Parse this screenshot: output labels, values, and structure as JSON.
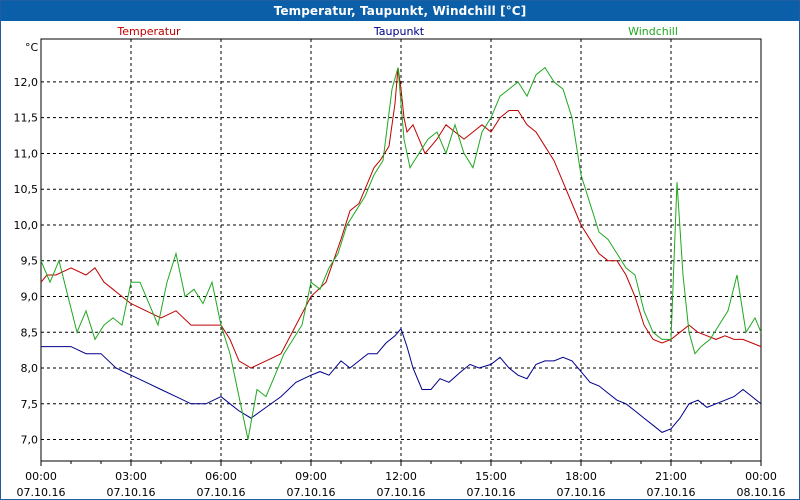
{
  "window": {
    "title": "Temperatur, Taupunkt, Windchill [°C]"
  },
  "colors": {
    "titlebar": "#0b5ea8",
    "grid": "#000000",
    "temperatur": "#c00000",
    "taupunkt": "#00008b",
    "windchill": "#1fa81f"
  },
  "chart_data": {
    "type": "line",
    "title": "Temperatur, Taupunkt, Windchill [°C]",
    "ylabel": "°C",
    "xlabel": "",
    "ylim": [
      6.7,
      12.6
    ],
    "xlim": [
      0,
      24
    ],
    "grid": true,
    "legend_placement": "top",
    "y_ticks": [
      {
        "value": 7.0,
        "label": "7,0"
      },
      {
        "value": 7.5,
        "label": "7,5"
      },
      {
        "value": 8.0,
        "label": "8,0"
      },
      {
        "value": 8.5,
        "label": "8,5"
      },
      {
        "value": 9.0,
        "label": "9,0"
      },
      {
        "value": 9.5,
        "label": "9,5"
      },
      {
        "value": 10.0,
        "label": "10,0"
      },
      {
        "value": 10.5,
        "label": "10,5"
      },
      {
        "value": 11.0,
        "label": "11,0"
      },
      {
        "value": 11.5,
        "label": "11,5"
      },
      {
        "value": 12.0,
        "label": "12,0"
      }
    ],
    "x_ticks": [
      {
        "value": 0,
        "time": "00:00",
        "date": "07.10.16"
      },
      {
        "value": 3,
        "time": "03:00",
        "date": "07.10.16"
      },
      {
        "value": 6,
        "time": "06:00",
        "date": "07.10.16"
      },
      {
        "value": 9,
        "time": "09:00",
        "date": "07.10.16"
      },
      {
        "value": 12,
        "time": "12:00",
        "date": "07.10.16"
      },
      {
        "value": 15,
        "time": "15:00",
        "date": "07.10.16"
      },
      {
        "value": 18,
        "time": "18:00",
        "date": "07.10.16"
      },
      {
        "value": 21,
        "time": "21:00",
        "date": "07.10.16"
      },
      {
        "value": 24,
        "time": "00:00",
        "date": "08.10.16"
      }
    ],
    "series": [
      {
        "name": "Temperatur",
        "color": "#c00000",
        "x": [
          0,
          0.2,
          0.5,
          1.0,
          1.5,
          1.8,
          2.1,
          2.4,
          2.7,
          3.0,
          3.5,
          4.0,
          4.5,
          5.0,
          5.5,
          6.0,
          6.3,
          6.6,
          7.0,
          7.5,
          8.0,
          8.5,
          9.0,
          9.5,
          10.0,
          10.3,
          10.6,
          10.9,
          11.1,
          11.3,
          11.6,
          11.8,
          11.9,
          12.0,
          12.1,
          12.2,
          12.4,
          12.6,
          12.8,
          13.0,
          13.2,
          13.5,
          13.8,
          14.1,
          14.4,
          14.7,
          15.0,
          15.3,
          15.6,
          15.9,
          16.2,
          16.5,
          16.8,
          17.1,
          17.4,
          17.7,
          18.0,
          18.3,
          18.6,
          18.9,
          19.2,
          19.5,
          19.8,
          20.1,
          20.4,
          20.7,
          21.0,
          21.3,
          21.6,
          21.9,
          22.2,
          22.5,
          22.8,
          23.1,
          23.4,
          23.7,
          24.0
        ],
        "values": [
          9.2,
          9.3,
          9.3,
          9.4,
          9.3,
          9.4,
          9.2,
          9.1,
          9.0,
          8.9,
          8.8,
          8.7,
          8.8,
          8.6,
          8.6,
          8.6,
          8.4,
          8.1,
          8.0,
          8.1,
          8.2,
          8.6,
          9.0,
          9.2,
          9.8,
          10.2,
          10.3,
          10.6,
          10.8,
          10.9,
          11.1,
          11.7,
          12.2,
          11.9,
          11.5,
          11.3,
          11.4,
          11.2,
          11.0,
          11.1,
          11.2,
          11.4,
          11.3,
          11.2,
          11.3,
          11.4,
          11.3,
          11.5,
          11.6,
          11.6,
          11.4,
          11.3,
          11.1,
          10.9,
          10.6,
          10.3,
          10.0,
          9.8,
          9.6,
          9.5,
          9.5,
          9.3,
          9.0,
          8.6,
          8.4,
          8.35,
          8.4,
          8.5,
          8.6,
          8.5,
          8.45,
          8.4,
          8.45,
          8.4,
          8.4,
          8.35,
          8.3
        ]
      },
      {
        "name": "Taupunkt",
        "color": "#00008b",
        "x": [
          0,
          0.5,
          1.0,
          1.5,
          2.0,
          2.5,
          3.0,
          3.5,
          4.0,
          4.5,
          5.0,
          5.5,
          6.0,
          6.3,
          6.6,
          7.0,
          7.5,
          8.0,
          8.5,
          9.0,
          9.3,
          9.6,
          10.0,
          10.3,
          10.6,
          10.9,
          11.2,
          11.5,
          11.8,
          12.0,
          12.2,
          12.4,
          12.7,
          13.0,
          13.3,
          13.6,
          14.0,
          14.3,
          14.6,
          15.0,
          15.3,
          15.6,
          15.9,
          16.2,
          16.5,
          16.8,
          17.1,
          17.4,
          17.7,
          18.0,
          18.3,
          18.6,
          18.9,
          19.2,
          19.5,
          19.8,
          20.1,
          20.4,
          20.7,
          21.0,
          21.3,
          21.6,
          21.9,
          22.2,
          22.5,
          22.8,
          23.1,
          23.4,
          23.7,
          24.0
        ],
        "values": [
          8.3,
          8.3,
          8.3,
          8.2,
          8.2,
          8.0,
          7.9,
          7.8,
          7.7,
          7.6,
          7.5,
          7.5,
          7.6,
          7.5,
          7.4,
          7.3,
          7.45,
          7.6,
          7.8,
          7.9,
          7.95,
          7.9,
          8.1,
          8.0,
          8.1,
          8.2,
          8.2,
          8.35,
          8.45,
          8.55,
          8.3,
          8.0,
          7.7,
          7.7,
          7.85,
          7.8,
          7.95,
          8.05,
          8.0,
          8.05,
          8.15,
          8.0,
          7.9,
          7.85,
          8.05,
          8.1,
          8.1,
          8.15,
          8.1,
          7.95,
          7.8,
          7.75,
          7.65,
          7.55,
          7.5,
          7.4,
          7.3,
          7.2,
          7.1,
          7.15,
          7.3,
          7.5,
          7.55,
          7.45,
          7.5,
          7.55,
          7.6,
          7.7,
          7.6,
          7.5
        ]
      },
      {
        "name": "Windchill",
        "color": "#1fa81f",
        "x": [
          0,
          0.3,
          0.6,
          0.9,
          1.2,
          1.5,
          1.8,
          2.1,
          2.4,
          2.7,
          3.0,
          3.3,
          3.6,
          3.9,
          4.2,
          4.5,
          4.8,
          5.1,
          5.4,
          5.7,
          6.0,
          6.3,
          6.6,
          6.9,
          7.2,
          7.5,
          7.8,
          8.1,
          8.4,
          8.7,
          9.0,
          9.3,
          9.6,
          9.9,
          10.2,
          10.5,
          10.8,
          11.1,
          11.4,
          11.7,
          11.9,
          12.1,
          12.3,
          12.6,
          12.9,
          13.2,
          13.5,
          13.8,
          14.1,
          14.4,
          14.7,
          15.0,
          15.3,
          15.6,
          15.9,
          16.2,
          16.5,
          16.8,
          17.1,
          17.4,
          17.7,
          18.0,
          18.3,
          18.6,
          18.9,
          19.2,
          19.5,
          19.8,
          20.1,
          20.4,
          20.7,
          21.0,
          21.2,
          21.4,
          21.6,
          21.8,
          22.0,
          22.3,
          22.6,
          22.9,
          23.2,
          23.5,
          23.8,
          24.0
        ],
        "values": [
          9.5,
          9.2,
          9.5,
          9.0,
          8.5,
          8.8,
          8.4,
          8.6,
          8.7,
          8.6,
          9.2,
          9.2,
          8.9,
          8.6,
          9.2,
          9.6,
          9.0,
          9.1,
          8.9,
          9.2,
          8.6,
          8.2,
          7.6,
          7.0,
          7.7,
          7.6,
          7.9,
          8.2,
          8.4,
          8.6,
          9.2,
          9.1,
          9.4,
          9.6,
          10.0,
          10.2,
          10.4,
          10.7,
          10.9,
          11.9,
          12.2,
          11.2,
          10.8,
          11.0,
          11.2,
          11.3,
          11.0,
          11.4,
          11.0,
          10.8,
          11.3,
          11.5,
          11.8,
          11.9,
          12.0,
          11.8,
          12.1,
          12.2,
          12.0,
          11.9,
          11.5,
          10.7,
          10.3,
          9.9,
          9.8,
          9.6,
          9.4,
          9.3,
          8.8,
          8.5,
          8.4,
          8.4,
          10.6,
          9.3,
          8.5,
          8.2,
          8.3,
          8.4,
          8.6,
          8.8,
          9.3,
          8.5,
          8.7,
          8.5
        ]
      }
    ]
  }
}
